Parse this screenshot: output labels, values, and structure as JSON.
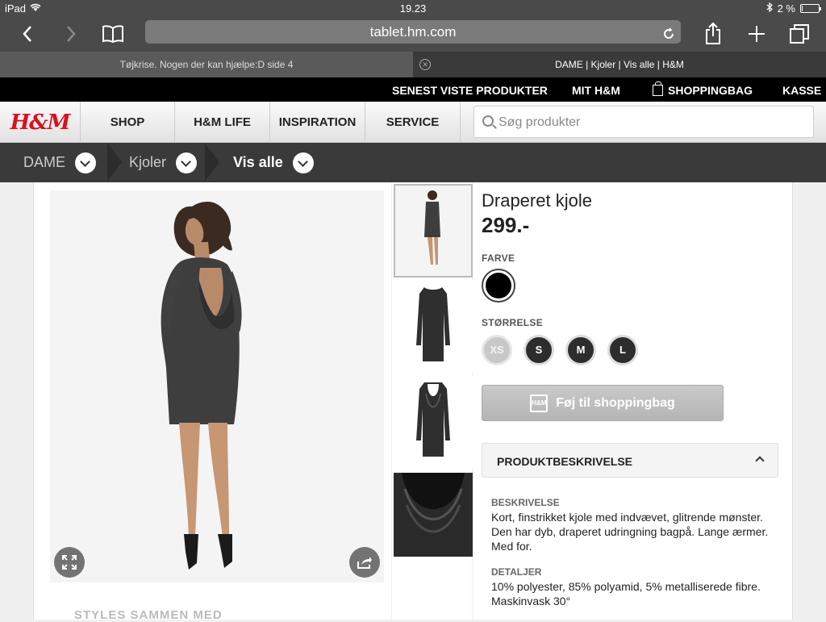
{
  "status_bar": {
    "device": "iPad",
    "time": "19.23",
    "battery": "2 %",
    "battery_level": 0.02
  },
  "browser": {
    "url": "tablet.hm.com",
    "tabs": [
      {
        "title": "Tøjkrise. Nogen der kan hjælpe:D side 4"
      },
      {
        "title": "DAME | Kjoler | Vis alle | H&M"
      }
    ]
  },
  "topbar": {
    "recent": "SENEST VISTE PRODUKTER",
    "my_hm": "MIT H&M",
    "bag": "SHOPPINGBAG",
    "checkout": "KASSE"
  },
  "nav": {
    "logo": "H&M",
    "items": [
      "SHOP",
      "H&M LIFE",
      "INSPIRATION",
      "SERVICE"
    ],
    "search_placeholder": "Søg produkter"
  },
  "breadcrumb": [
    "DAME",
    "Kjoler",
    "Vis alle"
  ],
  "product": {
    "title": "Draperet kjole",
    "price": "299.-",
    "color_label": "FARVE",
    "size_label": "STØRRELSE",
    "sizes": [
      "XS",
      "S",
      "M",
      "L"
    ],
    "add_to_bag": "Føj til shoppingbag",
    "add_icon_text": "H&M",
    "accordion_label": "PRODUKTBESKRIVELSE",
    "description_heading": "BESKRIVELSE",
    "description": "Kort, finstrikket kjole med indvævet, glitrende mønster. Den har dyb, draperet udringning bagpå. Lange ærmer. Med for.",
    "details_heading": "DETALJER",
    "details": "10% polyester, 85% polyamid, 5% metalliserede fibre. Maskinvask 30°"
  },
  "styles_heading": "STYLES SAMMEN MED",
  "colors": {
    "hm_red": "#d9101f",
    "topbar": "#000000",
    "breadcrumb": "#3a3a3a"
  }
}
